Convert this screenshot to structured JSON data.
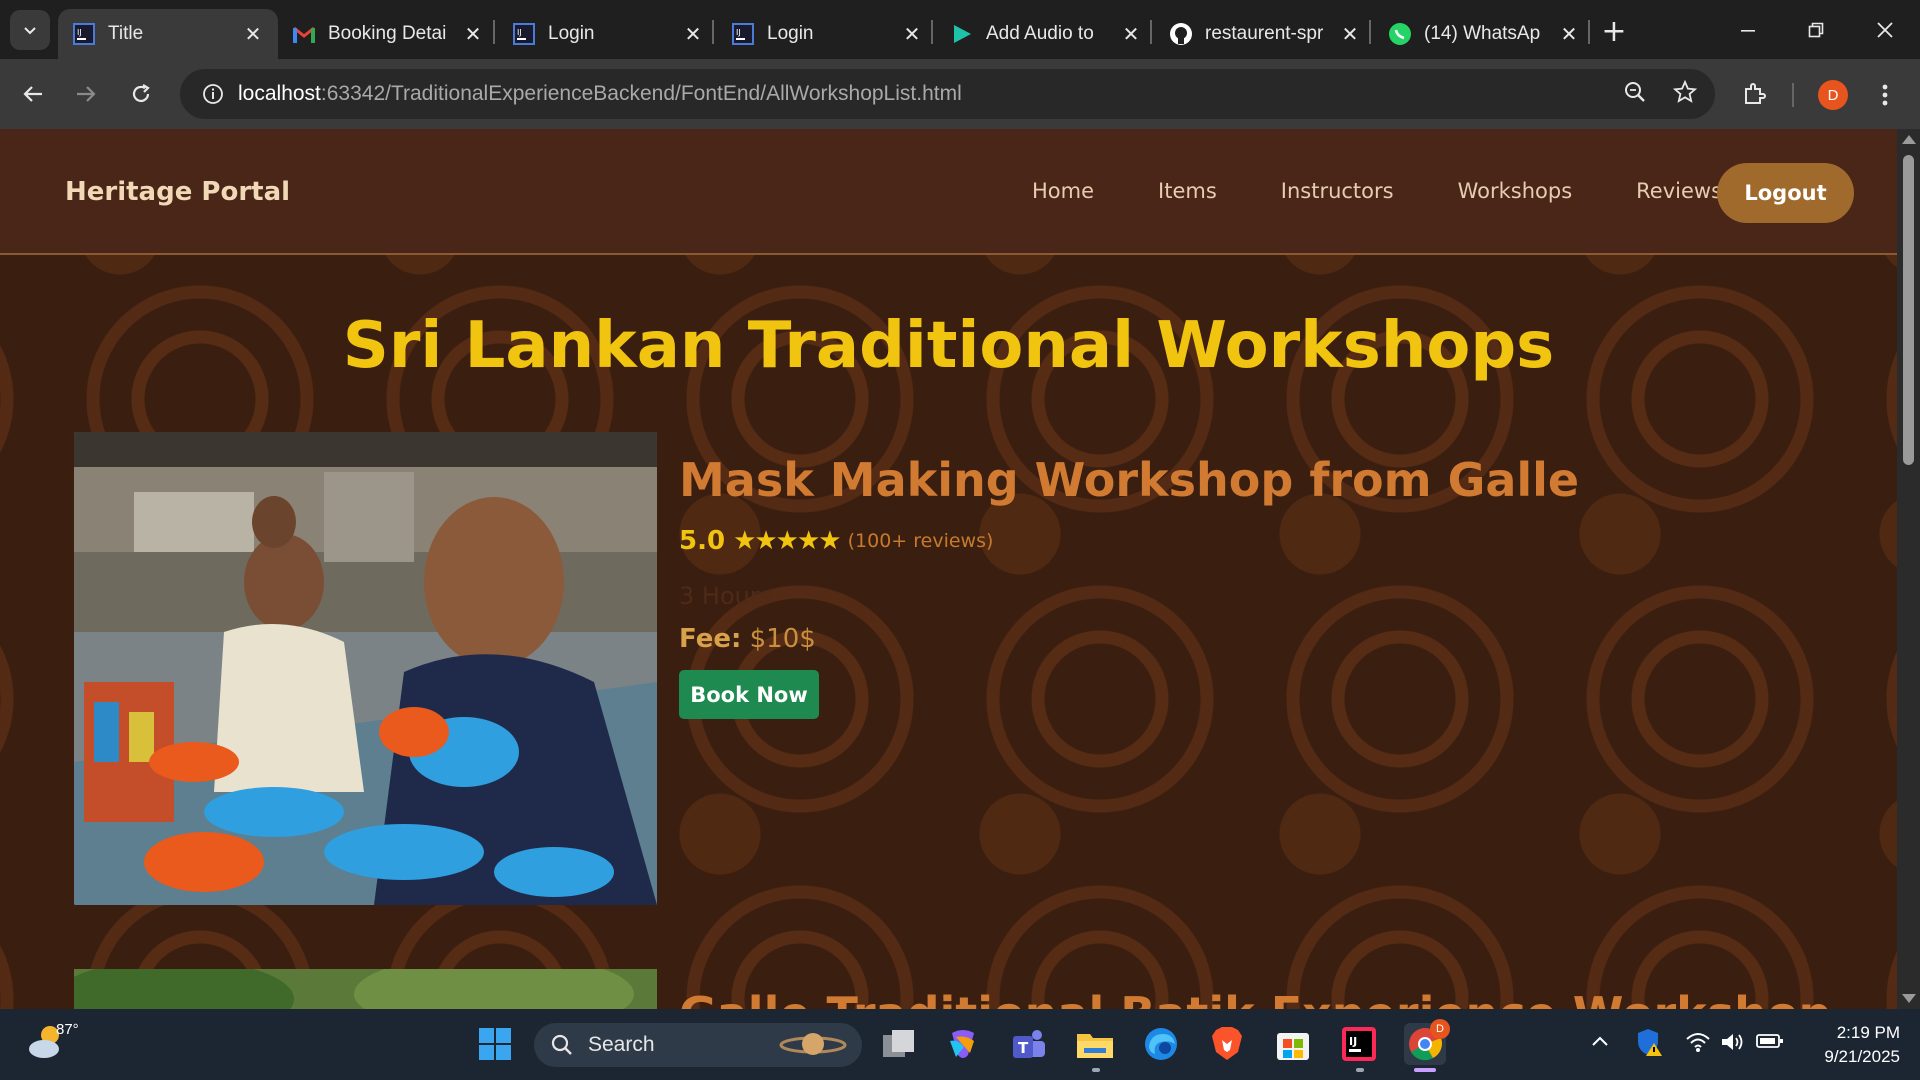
{
  "browser": {
    "tabs": [
      {
        "title": "Title",
        "favicon": "intellij-icon",
        "active": true
      },
      {
        "title": "Booking Detai",
        "favicon": "gmail-icon",
        "active": false
      },
      {
        "title": "Login",
        "favicon": "intellij-icon",
        "active": false
      },
      {
        "title": "Login",
        "favicon": "intellij-icon",
        "active": false
      },
      {
        "title": "Add Audio to",
        "favicon": "play-icon",
        "active": false
      },
      {
        "title": "restaurent-spr",
        "favicon": "github-icon",
        "active": false
      },
      {
        "title": "(14) WhatsAp",
        "favicon": "whatsapp-icon",
        "active": false
      }
    ],
    "url_host": "localhost",
    "url_rest": ":63342/TraditionalExperienceBackend/FontEnd/AllWorkshopList.html",
    "profile_initial": "D"
  },
  "site": {
    "brand": "Heritage Portal",
    "nav": [
      "Home",
      "Items",
      "Instructors",
      "Workshops",
      "Reviews"
    ],
    "logout_label": "Logout",
    "page_title": "Sri Lankan Traditional Workshops"
  },
  "workshops": [
    {
      "title": "Mask Making Workshop from Galle",
      "rating": "5.0",
      "stars": "★★★★★",
      "reviews": "(100+ reviews)",
      "duration": "3 Hours",
      "fee_label": "Fee:",
      "fee_value": "$10$",
      "book_label": "Book Now"
    },
    {
      "title": "Galle Traditional Batik Experience Workshop"
    }
  ],
  "taskbar": {
    "temperature": "87°",
    "search_label": "Search",
    "time": "2:19 PM",
    "date": "9/21/2025",
    "chrome_badge": "D"
  },
  "colors": {
    "accent_gold": "#f1c40f",
    "workshop_title": "#d07a32",
    "book_button": "#1e8a50",
    "logout_button": "#a06a2c",
    "navbar_bg": "#4a2618"
  }
}
